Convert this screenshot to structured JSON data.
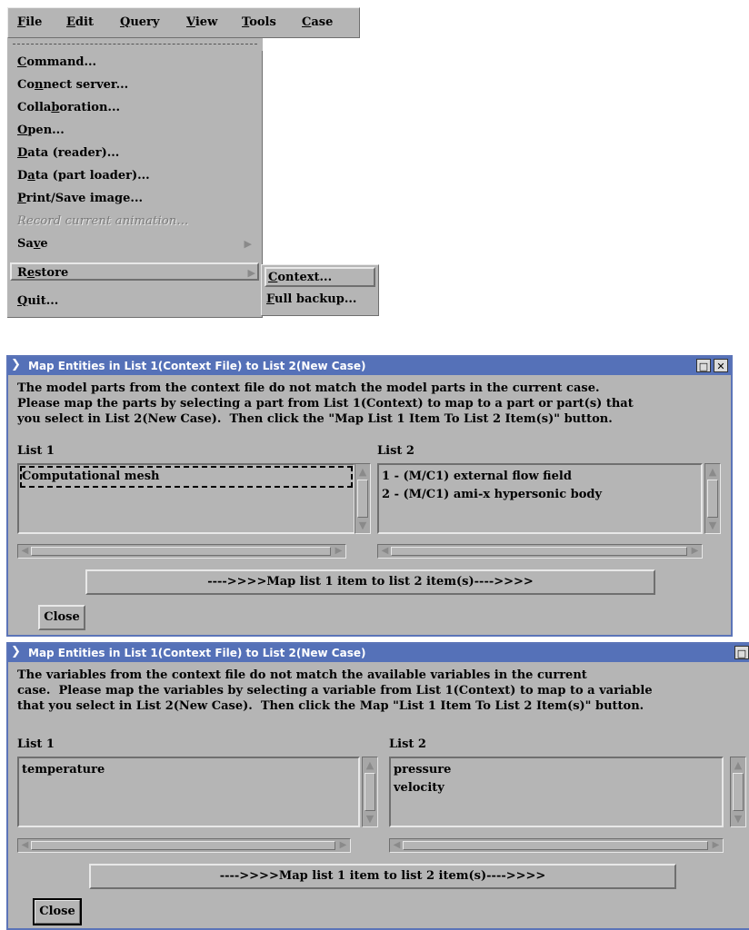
{
  "menubar": {
    "items": [
      {
        "label": "File",
        "mnemonic": "F",
        "rest": "ile"
      },
      {
        "label": "Edit",
        "mnemonic": "E",
        "rest": "dit"
      },
      {
        "label": "Query",
        "mnemonic": "Q",
        "rest": "uery"
      },
      {
        "label": "View",
        "mnemonic": "V",
        "rest": "iew"
      },
      {
        "label": "Tools",
        "mnemonic": "T",
        "rest": "ools"
      },
      {
        "label": "Case",
        "mnemonic": "C",
        "rest": "ase"
      }
    ]
  },
  "file_menu": {
    "items": [
      {
        "label": "Command...",
        "pre": "",
        "mn": "C",
        "post": "ommand..."
      },
      {
        "label": "Connect server...",
        "pre": "Co",
        "mn": "n",
        "post": "nect server..."
      },
      {
        "label": "Collaboration...",
        "pre": "Colla",
        "mn": "b",
        "post": "oration..."
      },
      {
        "label": "Open...",
        "pre": "",
        "mn": "O",
        "post": "pen..."
      },
      {
        "label": "Data (reader)...",
        "pre": "",
        "mn": "D",
        "post": "ata (reader)..."
      },
      {
        "label": "Data (part loader)...",
        "pre": "D",
        "mn": "a",
        "post": "ta (part loader)..."
      },
      {
        "label": "Print/Save image...",
        "pre": "",
        "mn": "P",
        "post": "rint/Save image..."
      },
      {
        "label": "Record current animation...",
        "pre": "",
        "mn": "",
        "post": "Record current animation..."
      },
      {
        "label": "Save",
        "pre": "Sa",
        "mn": "v",
        "post": "e"
      },
      {
        "label": "Restore",
        "pre": "R",
        "mn": "e",
        "post": "store"
      },
      {
        "label": "Quit...",
        "pre": "",
        "mn": "Q",
        "post": "uit..."
      }
    ],
    "cascade_arrow": "▶"
  },
  "restore_submenu": {
    "items": [
      {
        "label": "Context...",
        "mn": "C",
        "post": "ontext..."
      },
      {
        "label": "Full backup...",
        "mn": "F",
        "post": "ull backup..."
      }
    ]
  },
  "dialog1": {
    "title": "Map Entities in List 1(Context File) to List 2(New Case)",
    "message": "The model parts from the context file do not match the model parts in the current case.\nPlease map the parts by selecting a part from List 1(Context) to map to a part or part(s) that\nyou select in List 2(New Case).  Then click the \"Map List 1 Item To List 2 Item(s)\" button.",
    "list1_label": "List 1",
    "list2_label": "List 2",
    "list1_items": [
      "Computational mesh"
    ],
    "list2_items": [
      "1 - (M/C1) external flow field",
      "2 - (M/C1) ami-x hypersonic body"
    ],
    "map_button": "---->>>>Map list 1 item to list 2 item(s)---->>>>",
    "close_button": "Close"
  },
  "dialog2": {
    "title": "Map Entities in List 1(Context File) to List 2(New Case)",
    "message": "The variables from the context file do not match the available variables in the current\ncase.  Please map the variables by selecting a variable from List 1(Context) to map to a variable\nthat you select in List 2(New Case).  Then click the Map \"List 1 Item To List 2 Item(s)\" button.",
    "list1_label": "List 1",
    "list2_label": "List 2",
    "list1_items": [
      "temperature"
    ],
    "list2_items": [
      "pressure",
      "velocity"
    ],
    "map_button": "---->>>>Map list 1 item to list 2 item(s)---->>>>",
    "close_button": "Close"
  },
  "icons": {
    "window_menu": "chevron-down-icon",
    "maximize": "maximize-icon",
    "close": "close-icon"
  }
}
